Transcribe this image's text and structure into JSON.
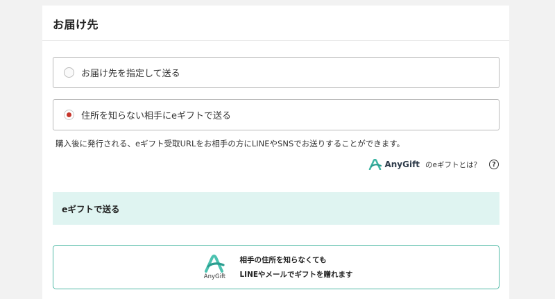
{
  "section": {
    "title": "お届け先"
  },
  "options": [
    {
      "label": "お届け先を指定して送る",
      "selected": false
    },
    {
      "label": "住所を知らない相手にeギフトで送る",
      "selected": true
    }
  ],
  "note": "購入後に発行される、eギフト受取URLをお相手の方にLINEやSNSでお送りすることができます。",
  "anygift_info": {
    "logo_text": "AnyGift",
    "link_text": "のeギフトとは？",
    "help_glyph": "?"
  },
  "egift_section": {
    "title": "eギフトで送る"
  },
  "send_option": {
    "logo_text": "AnyGift",
    "line1": "相手の住所を知らなくても",
    "line2": "LINEやメールでギフトを贈れます"
  },
  "colors": {
    "accent_teal": "#3fb6a4",
    "selected_radio": "#c6362c",
    "band_bg": "#dff4f1"
  }
}
